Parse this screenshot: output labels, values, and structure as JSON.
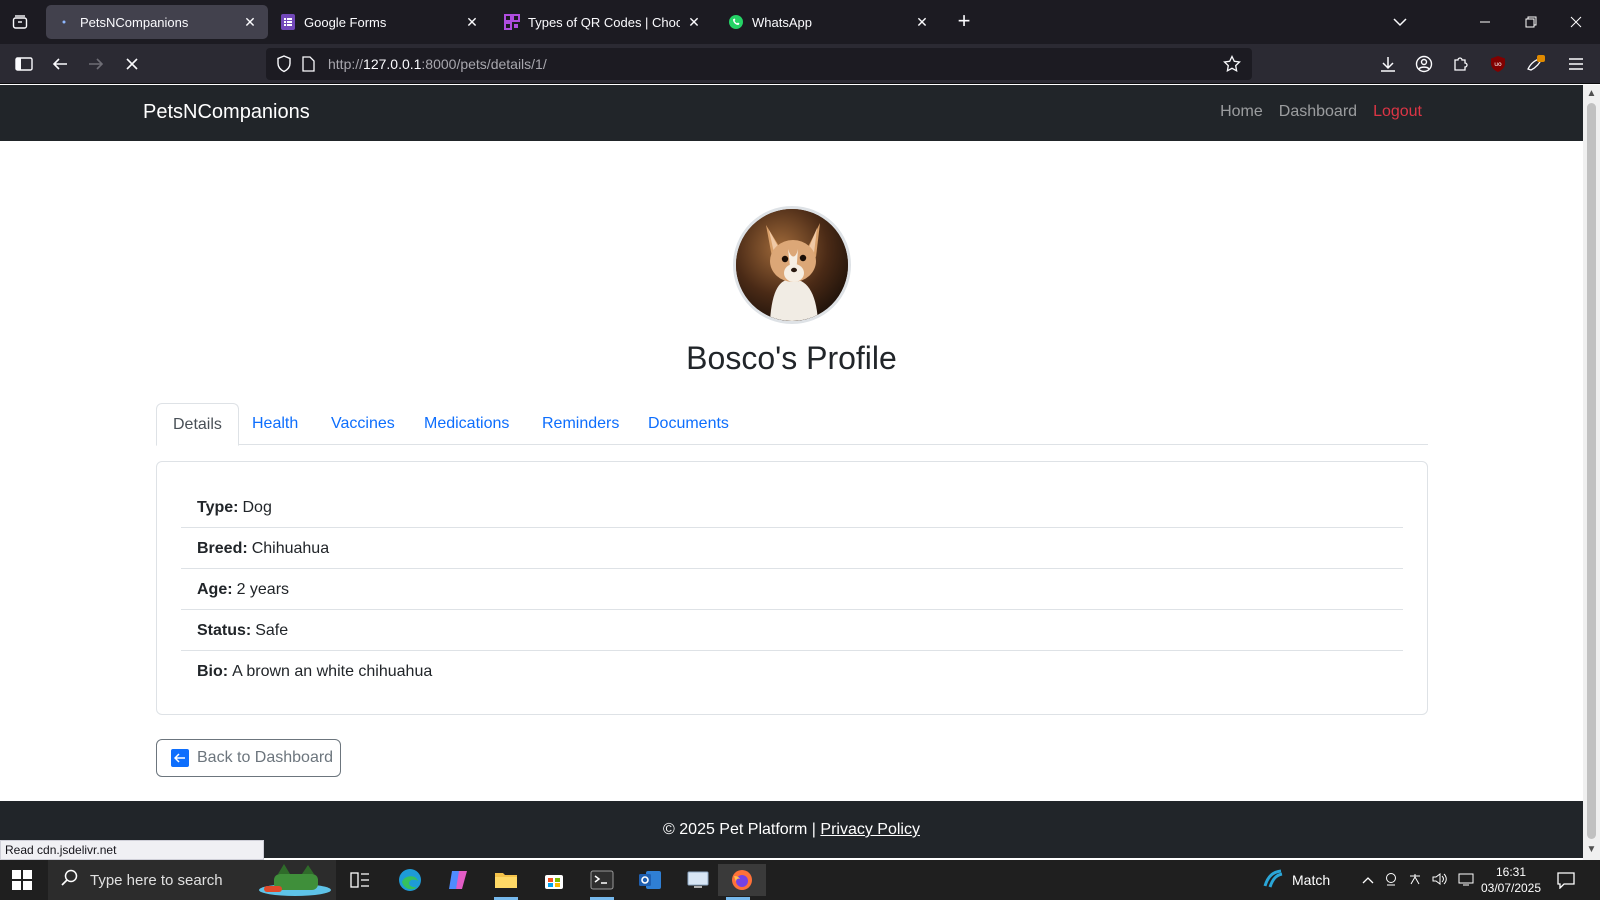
{
  "browser": {
    "tabs": [
      {
        "title": "PetsNCompanions",
        "active": true
      },
      {
        "title": "Google Forms",
        "active": false
      },
      {
        "title": "Types of QR Codes | Choose dif",
        "active": false
      },
      {
        "title": "WhatsApp",
        "active": false
      }
    ],
    "url": {
      "scheme": "http://",
      "host": "127.0.0.1",
      "rest": ":8000/pets/details/1/"
    },
    "status_text": "Read cdn.jsdelivr.net"
  },
  "site": {
    "brand": "PetsNCompanions",
    "nav": {
      "home": "Home",
      "dashboard": "Dashboard",
      "logout": "Logout"
    },
    "colors": {
      "navbar": "#212529",
      "link": "#0d6efd",
      "logout": "#dc3545"
    }
  },
  "profile": {
    "title": "Bosco's Profile",
    "tabs": [
      "Details",
      "Health",
      "Vaccines",
      "Medications",
      "Reminders",
      "Documents"
    ],
    "active_tab": "Details",
    "details": [
      {
        "label": "Type:",
        "value": "Dog"
      },
      {
        "label": "Breed:",
        "value": "Chihuahua"
      },
      {
        "label": "Age:",
        "value": "2 years"
      },
      {
        "label": "Status:",
        "value": "Safe"
      },
      {
        "label": "Bio:",
        "value": "A brown an white chihuahua"
      }
    ],
    "back_button": "Back to Dashboard"
  },
  "footer": {
    "text": "© 2025 Pet Platform |",
    "privacy": "Privacy Policy"
  },
  "taskbar": {
    "search_placeholder": "Type here to search",
    "weather_label": "Match",
    "time": "16:31",
    "date": "03/07/2025"
  }
}
